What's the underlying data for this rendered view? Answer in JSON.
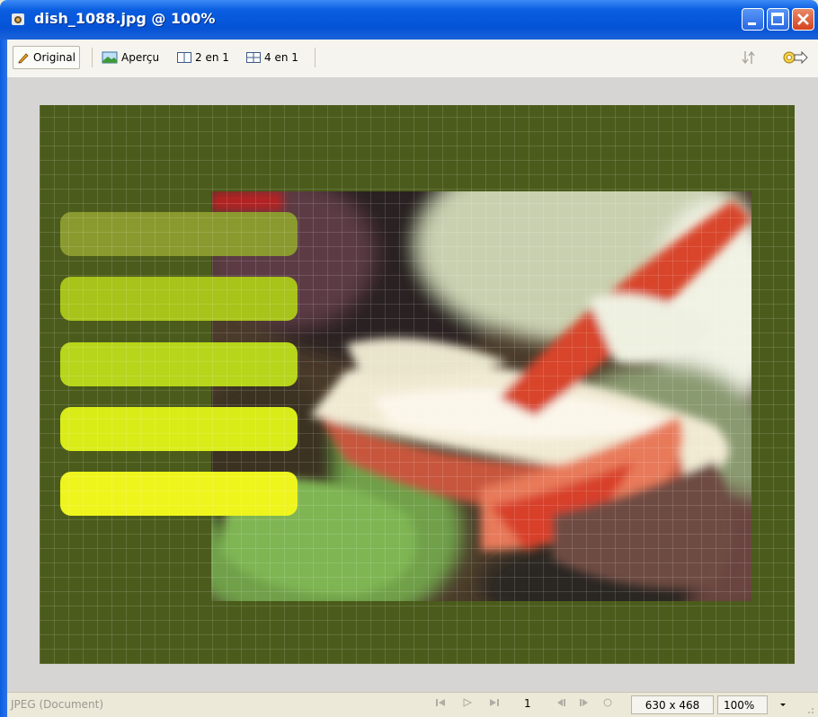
{
  "window": {
    "title": "dish_1088.jpg @ 100%"
  },
  "toolbar": {
    "original_label": "Original",
    "apercu_label": "Aperçu",
    "two_up_label": "2 en 1",
    "four_up_label": "4 en 1"
  },
  "canvas": {
    "background_color": "#4b5b1b",
    "bars": [
      {
        "color": "#8a9a2e"
      },
      {
        "color": "#a8c319"
      },
      {
        "color": "#b7d51a"
      },
      {
        "color": "#d9ec18"
      },
      {
        "color": "#eef51c"
      }
    ]
  },
  "statusbar": {
    "doc_type": "JPEG (Document)",
    "frame_number": "1",
    "dimensions": "630 x 468",
    "zoom": "100%"
  }
}
